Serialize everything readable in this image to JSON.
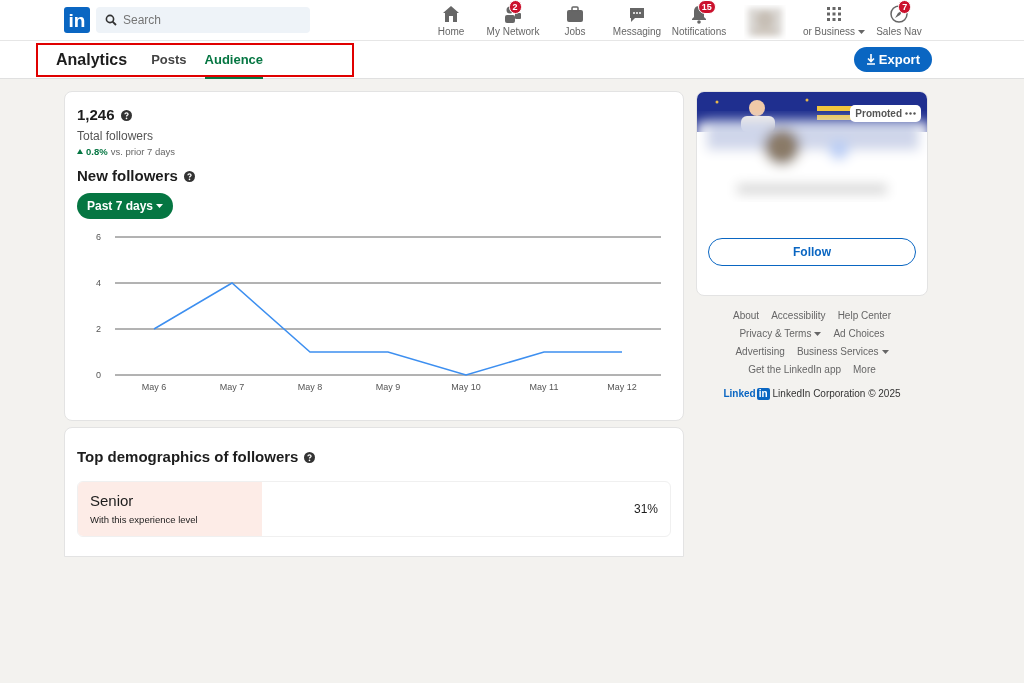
{
  "nav": {
    "logo": "in",
    "search": {
      "placeholder": "Search"
    },
    "items": [
      {
        "label": "Home"
      },
      {
        "label": "My Network",
        "badge": "2"
      },
      {
        "label": "Jobs"
      },
      {
        "label": "Messaging"
      },
      {
        "label": "Notifications",
        "badge": "15"
      },
      {
        "kind": "avatar"
      },
      {
        "label": "or Business",
        "kind": "menu"
      },
      {
        "label": "Sales Nav",
        "badge": "7"
      }
    ]
  },
  "subnav": {
    "title": "Analytics",
    "highlighted": true,
    "tabs": [
      {
        "label": "Posts",
        "selected": false
      },
      {
        "label": "Audience",
        "selected": true
      }
    ],
    "export": "Export"
  },
  "followers": {
    "total": "1,246",
    "total_label": "Total followers",
    "change": "0.8%",
    "change_note": "vs. prior 7 days",
    "title": "New followers",
    "range": "Past 7 days",
    "chart_data": {
      "type": "line",
      "categories": [
        "May 6",
        "May 7",
        "May 8",
        "May 9",
        "May 10",
        "May 11",
        "May 12"
      ],
      "ylim": [
        0,
        6
      ],
      "yticks": [
        0,
        2,
        4,
        6
      ],
      "series": [
        {
          "color": "#3d8ff0",
          "values": [
            2,
            4,
            1,
            1,
            0,
            1,
            1
          ]
        }
      ]
    }
  },
  "demographics": {
    "title": "Top demographics of followers",
    "items": [
      {
        "label": "Senior",
        "sublabel": "With this experience level",
        "value": "31%",
        "level": 0.31
      }
    ]
  },
  "ad": {
    "badge": "Promoted",
    "follow": "Follow"
  },
  "footer": {
    "rows": [
      [
        {
          "label": "About"
        },
        {
          "label": "Accessibility"
        },
        {
          "label": "Help Center"
        }
      ],
      [
        {
          "label": "Privacy & Terms",
          "dropdown": true
        },
        {
          "label": "Ad Choices"
        }
      ],
      [
        {
          "label": "Advertising"
        },
        {
          "label": "Business Services",
          "dropdown": true
        }
      ],
      [
        {
          "label": "Get the LinkedIn app"
        },
        {
          "label": "More"
        }
      ]
    ],
    "brand": "Linked",
    "brand_box": "in",
    "copyright": "LinkedIn Corporation © 2025"
  }
}
